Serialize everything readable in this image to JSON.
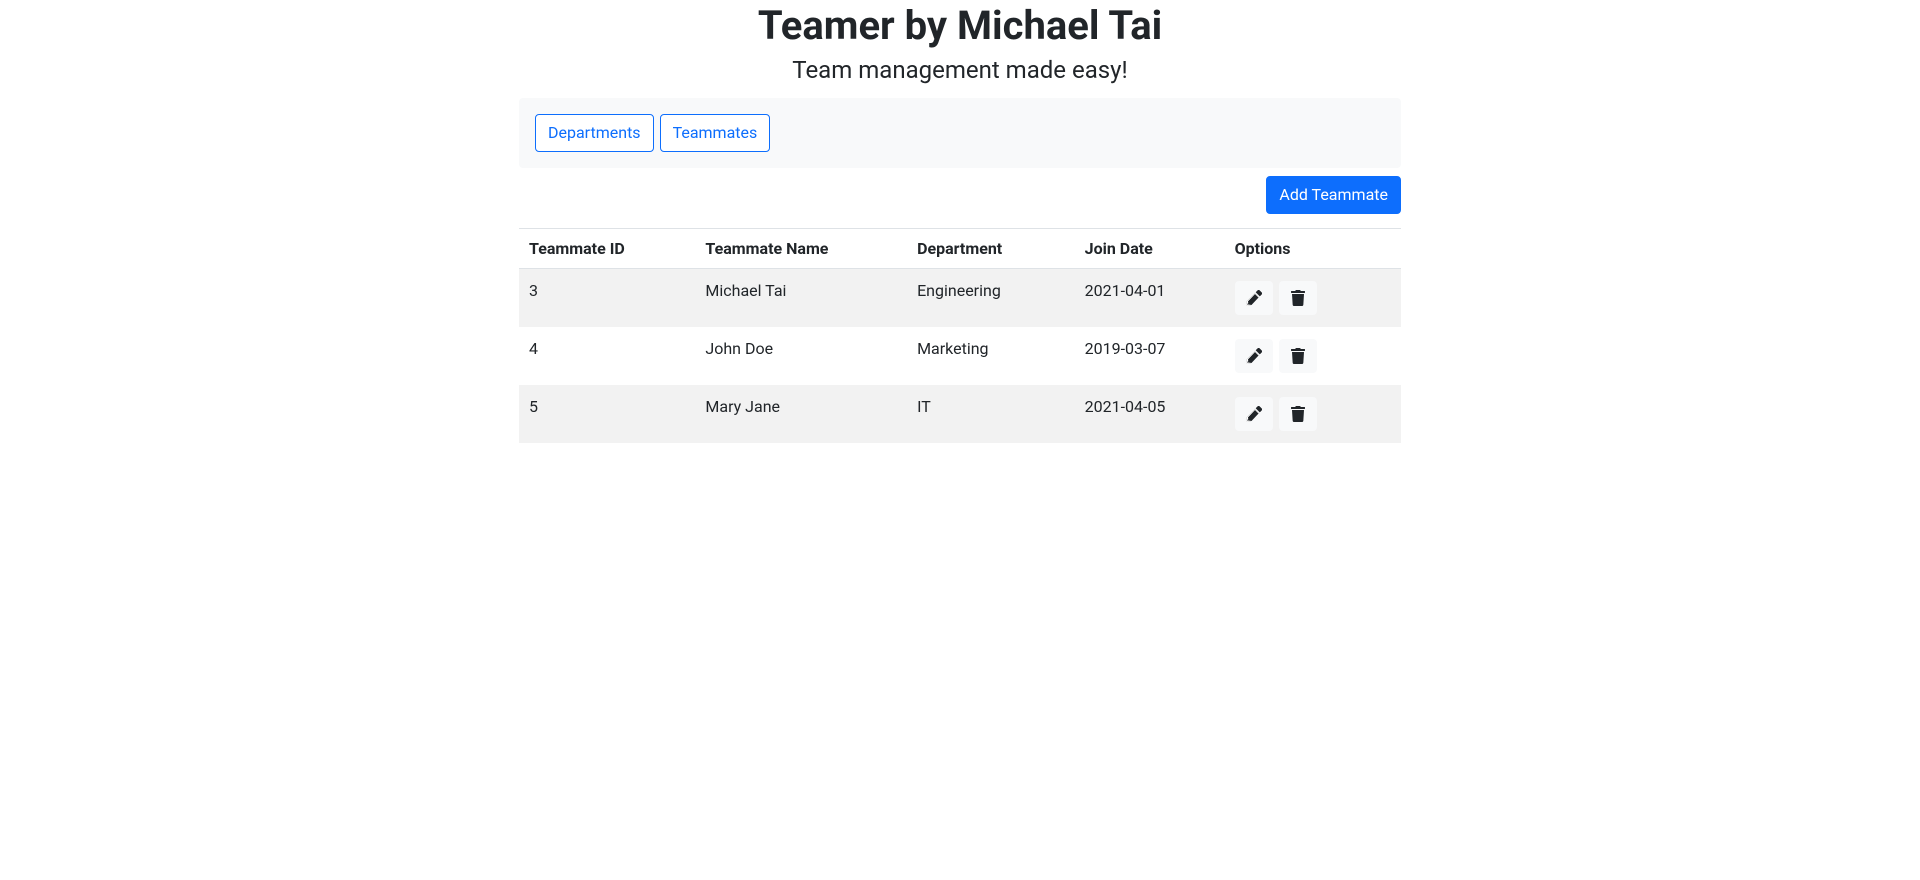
{
  "header": {
    "title": "Teamer by Michael Tai",
    "subtitle": "Team management made easy!"
  },
  "nav": {
    "departments_label": "Departments",
    "teammates_label": "Teammates"
  },
  "actions": {
    "add_teammate_label": "Add Teammate"
  },
  "table": {
    "columns": {
      "id": "Teammate ID",
      "name": "Teammate Name",
      "department": "Department",
      "join_date": "Join Date",
      "options": "Options"
    },
    "rows": [
      {
        "id": "3",
        "name": "Michael Tai",
        "department": "Engineering",
        "join_date": "2021-04-01"
      },
      {
        "id": "4",
        "name": "John Doe",
        "department": "Marketing",
        "join_date": "2019-03-07"
      },
      {
        "id": "5",
        "name": "Mary Jane",
        "department": "IT",
        "join_date": "2021-04-05"
      }
    ]
  },
  "icons": {
    "edit": "edit-icon",
    "delete": "trash-icon"
  }
}
